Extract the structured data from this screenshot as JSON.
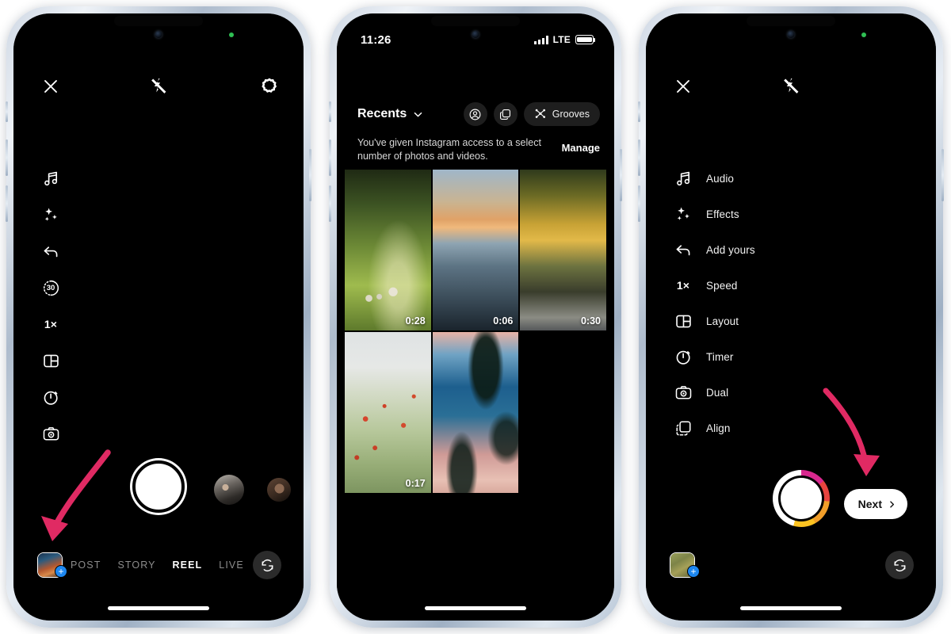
{
  "phones": {
    "camera": {
      "top_controls": [
        {
          "name": "close",
          "icon": "close-icon"
        },
        {
          "name": "flash-off",
          "icon": "flash-off-icon"
        },
        {
          "name": "settings",
          "icon": "gear-icon"
        }
      ],
      "tools": [
        {
          "icon": "music-note-icon",
          "label": "Audio"
        },
        {
          "icon": "sparkles-icon",
          "label": "Effects"
        },
        {
          "icon": "arrow-back-icon",
          "label": "Add yours"
        },
        {
          "icon": "duration-30-icon",
          "label": "30"
        },
        {
          "icon": "speed-icon",
          "label": "1×"
        },
        {
          "icon": "layout-icon",
          "label": "Layout"
        },
        {
          "icon": "timer-icon",
          "label": "Timer"
        },
        {
          "icon": "dual-camera-icon",
          "label": "Dual"
        }
      ],
      "speed_value": "1×",
      "duration_value": "30",
      "modes": [
        {
          "label": "POST",
          "active": false
        },
        {
          "label": "STORY",
          "active": false
        },
        {
          "label": "REEL",
          "active": true
        },
        {
          "label": "LIVE",
          "active": false
        }
      ],
      "gallery_thumb_badge": "+",
      "flip_camera_icon": "flip-camera-icon",
      "shutter_icon": "shutter-button"
    },
    "gallery": {
      "status": {
        "time": "11:26",
        "network": "LTE",
        "signal_icon": "cellular-signal-icon",
        "battery_icon": "battery-icon"
      },
      "header": {
        "album": "Recents",
        "chevron_icon": "chevron-down-icon",
        "pills": [
          {
            "name": "profile",
            "icon": "person-circle-icon",
            "label": ""
          },
          {
            "name": "layers",
            "icon": "stacked-squares-icon",
            "label": ""
          },
          {
            "name": "grooves",
            "icon": "grooves-icon",
            "label": "Grooves"
          }
        ]
      },
      "permission": {
        "message": "You've given Instagram access to a select number of photos and videos.",
        "action": "Manage"
      },
      "media": [
        {
          "name": "sheep-meadow",
          "duration": "0:28",
          "thumb": "t-sheep"
        },
        {
          "name": "ocean-sunset",
          "duration": "0:06",
          "thumb": "t-ocean"
        },
        {
          "name": "autumn-stream",
          "duration": "0:30",
          "thumb": "t-stream"
        },
        {
          "name": "poppy-field",
          "duration": "0:17",
          "thumb": "t-poppy"
        },
        {
          "name": "palm-trees",
          "duration": "",
          "thumb": "t-palm"
        }
      ]
    },
    "menu": {
      "top_controls": [
        {
          "name": "close",
          "icon": "close-icon"
        },
        {
          "name": "flash-off",
          "icon": "flash-off-icon"
        }
      ],
      "items": [
        {
          "icon": "music-note-icon",
          "label": "Audio"
        },
        {
          "icon": "sparkles-icon",
          "label": "Effects"
        },
        {
          "icon": "arrow-back-icon",
          "label": "Add yours"
        },
        {
          "icon": "speed-icon",
          "label": "Speed",
          "value": "1×"
        },
        {
          "icon": "layout-icon",
          "label": "Layout"
        },
        {
          "icon": "timer-icon",
          "label": "Timer"
        },
        {
          "icon": "dual-camera-icon",
          "label": "Dual"
        },
        {
          "icon": "align-icon",
          "label": "Align"
        }
      ],
      "next_button": "Next",
      "gallery_thumb_badge": "+",
      "flip_camera_icon": "flip-camera-icon"
    }
  },
  "annotations": {
    "arrow_color": "#e02a63",
    "arrow_1_target": "gallery-thumbnail-camera",
    "arrow_2_target": "next-button"
  }
}
